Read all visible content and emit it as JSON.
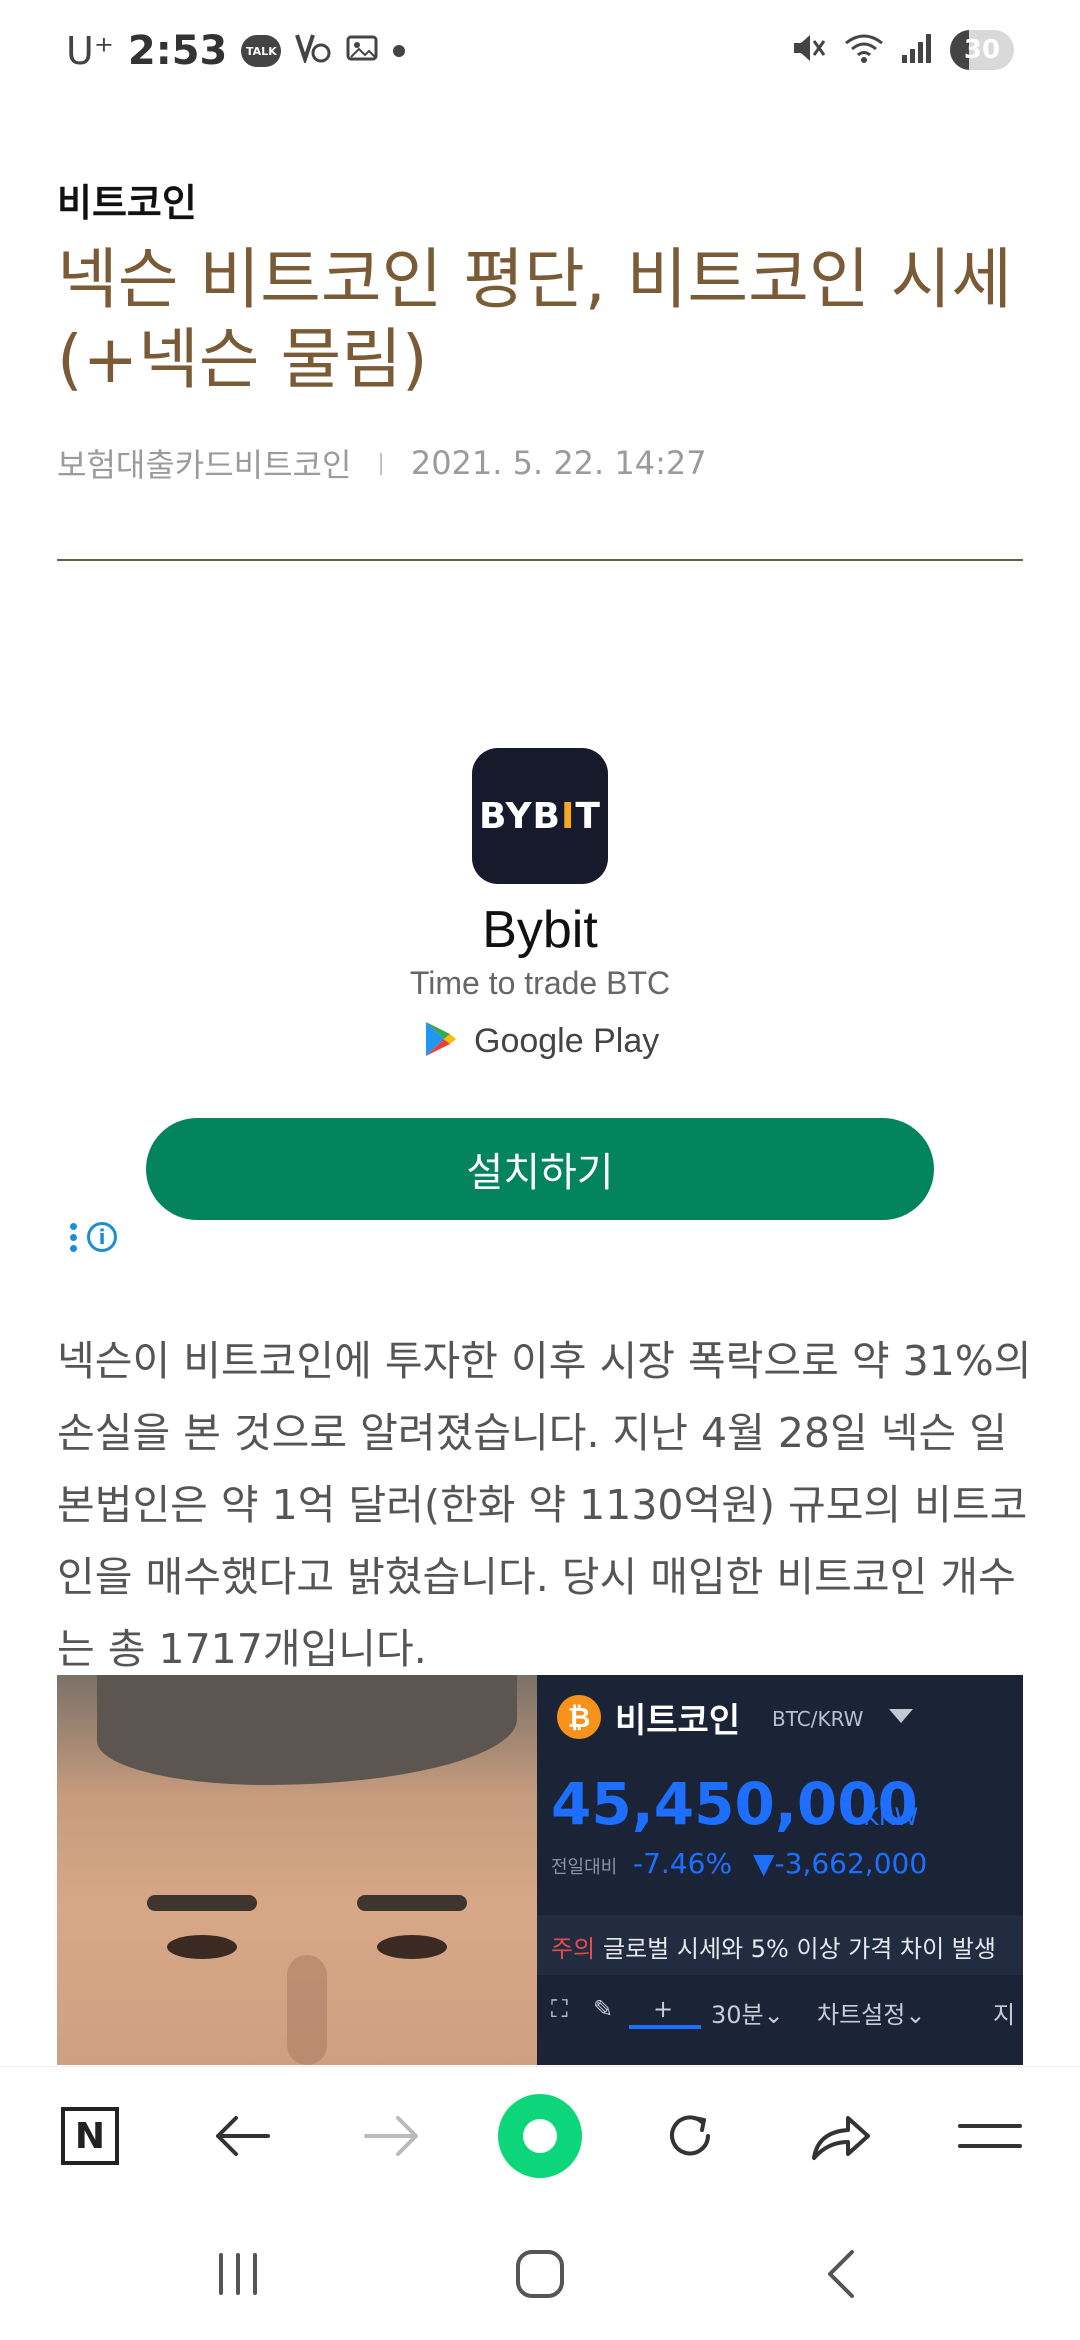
{
  "status_bar": {
    "carrier": "U⁺",
    "time": "2:53",
    "talk_badge": "TALK",
    "battery": "30",
    "battery_level": 0.3,
    "icons": [
      "kakaotalk-icon",
      "volte-icon",
      "screenshot-icon",
      "notification-dot-icon",
      "mute-icon",
      "wifi-icon",
      "signal-icon",
      "battery-icon"
    ]
  },
  "article": {
    "category": "비트코인",
    "title": "넥슨 비트코인 평단, 비트코인 시세 (+넥슨 물림)",
    "blog_name": "보험대출카드비트코인",
    "separator": "|",
    "date": "2021. 5. 22. 14:27",
    "body": "넥슨이 비트코인에 투자한 이후 시장 폭락으로 약 31%의 손실을 본 것으로 알려졌습니다. 지난 4월 28일 넥슨 일본법인은 약 1억 달러(한화 약 1130억원) 규모의 비트코인을 매수했다고 밝혔습니다. 당시 매입한 비트코인 개수는 총 1717개입니다."
  },
  "ad": {
    "app_icon_text_1": "BYB",
    "app_icon_text_bar": "I",
    "app_icon_text_2": "T",
    "app_name": "Bybit",
    "tagline": "Time to trade BTC",
    "store": "Google Play",
    "install_label": "설치하기",
    "info_symbol": "i"
  },
  "image_panel": {
    "coin_symbol": "₿",
    "coin_name": "비트코인",
    "pair": "BTC/KRW",
    "price": "45,450,000",
    "price_unit": "KRW",
    "change_label": "전일대비",
    "change_pct": "-7.46%",
    "change_amt": "▼-3,662,000",
    "warning_label": "주의",
    "warning_text": "글로벌 시세와 5% 이상 가격 차이 발생",
    "toolbar": [
      "⛶",
      "✎",
      "+",
      "30분⌄",
      "차트설정⌄",
      "지"
    ],
    "accent_color": "#1e6fff"
  },
  "browser_bar": {
    "n_label": "N",
    "icons": [
      "naver-home-icon",
      "back-arrow-icon",
      "forward-arrow-icon",
      "green-dot-icon",
      "refresh-icon",
      "share-icon",
      "menu-icon"
    ]
  },
  "nav_bar": {
    "icons": [
      "recent-apps-icon",
      "home-icon",
      "system-back-icon"
    ]
  }
}
